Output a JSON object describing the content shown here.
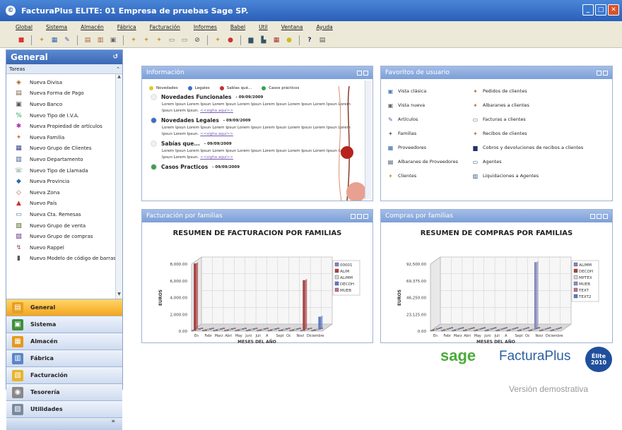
{
  "window": {
    "title": "FacturaPlus ELITE: 01  Empresa de pruebas Sage SP."
  },
  "menu": [
    "Global",
    "Sistema",
    "Almacén",
    "Fábrica",
    "Facturación",
    "Informes",
    "Babel",
    "Util",
    "Ventana",
    "Ayuda"
  ],
  "sidebar": {
    "title": "General",
    "section": "Tareas",
    "items": [
      {
        "label": "Nueva Divisa",
        "icon": "coins-icon"
      },
      {
        "label": "Nueva Forma de Pago",
        "icon": "payment-icon"
      },
      {
        "label": "Nuevo Banco",
        "icon": "bank-icon"
      },
      {
        "label": "Nuevo Tipo de I.V.A.",
        "icon": "tax-icon"
      },
      {
        "label": "Nueva Propiedad de artículos",
        "icon": "property-icon"
      },
      {
        "label": "Nueva Familia",
        "icon": "family-icon"
      },
      {
        "label": "Nuevo Grupo de Clientes",
        "icon": "group-icon"
      },
      {
        "label": "Nuevo Departamento",
        "icon": "department-icon"
      },
      {
        "label": "Nuevo Tipo de Llamada",
        "icon": "phone-icon"
      },
      {
        "label": "Nueva Provincia",
        "icon": "province-icon"
      },
      {
        "label": "Nueva Zona",
        "icon": "zone-icon"
      },
      {
        "label": "Nuevo País",
        "icon": "country-icon"
      },
      {
        "label": "Nueva Cta. Remesas",
        "icon": "remittance-icon"
      },
      {
        "label": "Nuevo Grupo de venta",
        "icon": "sales-group-icon"
      },
      {
        "label": "Nuevo Grupo de compras",
        "icon": "purchase-group-icon"
      },
      {
        "label": "Nuevo Rappel",
        "icon": "rappel-icon"
      },
      {
        "label": "Nuevo Modelo de código de barras",
        "icon": "barcode-icon"
      }
    ],
    "nav": [
      {
        "label": "General",
        "color": "#e8a020",
        "active": true
      },
      {
        "label": "Sistema",
        "color": "#3f8f3a",
        "active": false
      },
      {
        "label": "Almacén",
        "color": "#e39a1c",
        "active": false
      },
      {
        "label": "Fábrica",
        "color": "#5a86c8",
        "active": false
      },
      {
        "label": "Facturación",
        "color": "#e8b428",
        "active": false
      },
      {
        "label": "Tesorería",
        "color": "#888888",
        "active": false
      },
      {
        "label": "Utilidades",
        "color": "#7a8aa0",
        "active": false
      }
    ]
  },
  "info_panel": {
    "title": "Información",
    "legend": [
      {
        "label": "Novedades",
        "color": "#e0c830"
      },
      {
        "label": "Legales",
        "color": "#3a6fc0"
      },
      {
        "label": "Sabías qué...",
        "color": "#c03030"
      },
      {
        "label": "Casos prácticos",
        "color": "#3aa050"
      }
    ],
    "news": [
      {
        "title": "Novedades Funcionales",
        "date": "- 09/09/2009",
        "dot": "#f0f0f0",
        "body": "Lorem Ipsun Lorem Ipsun Lorem Ipsun Lorem Ipsun Lorem Ipsun Lorem Ipsun Lorem Ipsun Lorem Ipsun Lorem Ipsun.",
        "link": "<<sigha aquí>>"
      },
      {
        "title": "Novedades Legales",
        "date": "- 09/09/2009",
        "dot": "#3a6fc0",
        "body": "Lorem Ipsun Lorem Ipsun Lorem Ipsun Lorem Ipsun Lorem Ipsun Lorem Ipsun Lorem Ipsun Lorem Ipsun Lorem Ipsun.",
        "link": "<<sigha aquí>>"
      },
      {
        "title": "Sabías que...",
        "date": "- 09/09/2009",
        "dot": "#f0f0f0",
        "body": "Lorem Ipsun Lorem Ipsun Lorem Ipsun Lorem Ipsun Lorem Ipsun Lorem Ipsun Lorem Ipsun Lorem Ipsun Lorem Ipsun.",
        "link": "<<sigha aquí>>"
      },
      {
        "title": "Casos Practicos",
        "date": "- 09/09/2009",
        "dot": "#3aa050",
        "body": "",
        "link": ""
      }
    ]
  },
  "favorites": {
    "title": "Favoritos de usuario",
    "left": [
      {
        "label": "Vista clásica",
        "icon": "classic-view-icon"
      },
      {
        "label": "Vista nueva",
        "icon": "new-view-icon"
      },
      {
        "label": "Artículos",
        "icon": "articles-icon"
      },
      {
        "label": "Familias",
        "icon": "families-icon"
      },
      {
        "label": "Proveedores",
        "icon": "suppliers-icon"
      },
      {
        "label": "Albaranes de Proveedores",
        "icon": "supplier-notes-icon"
      },
      {
        "label": "Clientes",
        "icon": "clients-icon"
      }
    ],
    "right": [
      {
        "label": "Pedidos de clientes",
        "icon": "orders-icon"
      },
      {
        "label": "Albaranes a clientes",
        "icon": "delivery-notes-icon"
      },
      {
        "label": "Facturas a clientes",
        "icon": "invoices-icon"
      },
      {
        "label": "Recibos de clientes",
        "icon": "receipts-icon"
      },
      {
        "label": "Cobros y devoluciones de recibos a clientes",
        "icon": "collections-icon"
      },
      {
        "label": "Agentes",
        "icon": "agents-icon"
      },
      {
        "label": "Liquidaciones a Agentes",
        "icon": "settlements-icon"
      }
    ]
  },
  "billing_panel": {
    "title": "Facturación por familias"
  },
  "purchases_panel": {
    "title": "Compras por familias"
  },
  "chart_data": [
    {
      "type": "bar",
      "title": "RESUMEN DE FACTURACION POR FAMILIAS",
      "xlabel": "MESES DEL AÑO",
      "ylabel": "EUROS",
      "yticks": [
        "8,000.00",
        "6,000.00",
        "4,000.00",
        "2,000.00",
        "0.00"
      ],
      "ylim": [
        0,
        8000
      ],
      "categories": [
        "En",
        "Febr",
        "Marz",
        "Abri",
        "May",
        "Juni",
        "Juli",
        "A",
        "Sept",
        "Oc",
        "Novi",
        "Diciembre"
      ],
      "series": [
        {
          "name": "00001",
          "color": "#8a82c0",
          "values": [
            0,
            0,
            0,
            0,
            0,
            0,
            0,
            0,
            0,
            0,
            0,
            0
          ]
        },
        {
          "name": "ALIM",
          "color": "#b04040",
          "values": [
            8000,
            0,
            0,
            0,
            0,
            0,
            0,
            0,
            0,
            0,
            6000,
            0
          ]
        },
        {
          "name": "ALIMM",
          "color": "#d8d8d8",
          "values": [
            0,
            0,
            0,
            0,
            0,
            0,
            0,
            0,
            0,
            0,
            0,
            0
          ]
        },
        {
          "name": "DECOH",
          "color": "#5a7ad0",
          "values": [
            0,
            0,
            0,
            0,
            0,
            0,
            0,
            0,
            0,
            0,
            0,
            1500
          ]
        },
        {
          "name": "MUEB",
          "color": "#c07090",
          "values": [
            0,
            0,
            0,
            0,
            0,
            0,
            0,
            0,
            0,
            0,
            0,
            0
          ]
        }
      ]
    },
    {
      "type": "bar",
      "title": "RESUMEN DE COMPRAS POR FAMILIAS",
      "xlabel": "MESES DEL AÑO",
      "ylabel": "EUROS",
      "yticks": [
        "92,500.00",
        "69,375.00",
        "46,250.00",
        "23,125.00",
        "0.00"
      ],
      "ylim": [
        0,
        92500
      ],
      "categories": [
        "En",
        "Febr",
        "Marz",
        "Abri",
        "May",
        "Juni",
        "Juli",
        "A",
        "Sept",
        "Oc",
        "Novi",
        "Diciembre"
      ],
      "series": [
        {
          "name": "ALIMM",
          "color": "#8a82c0",
          "values": [
            0,
            0,
            0,
            0,
            0,
            0,
            0,
            0,
            0,
            0,
            0,
            0
          ]
        },
        {
          "name": "DECOH",
          "color": "#b04040",
          "values": [
            0,
            0,
            0,
            0,
            0,
            0,
            0,
            0,
            0,
            0,
            0,
            0
          ]
        },
        {
          "name": "MPTEX",
          "color": "#d8d8d8",
          "values": [
            0,
            0,
            0,
            0,
            0,
            0,
            0,
            0,
            0,
            0,
            0,
            0
          ]
        },
        {
          "name": "MUEB",
          "color": "#8a8fc8",
          "values": [
            0,
            0,
            0,
            0,
            0,
            0,
            0,
            0,
            0,
            92500,
            0,
            0
          ]
        },
        {
          "name": "TEXT",
          "color": "#c07090",
          "values": [
            0,
            0,
            0,
            0,
            0,
            0,
            0,
            0,
            0,
            0,
            0,
            0
          ]
        },
        {
          "name": "TEXT2",
          "color": "#5a7ad0",
          "values": [
            0,
            0,
            0,
            0,
            0,
            0,
            0,
            0,
            0,
            0,
            0,
            0
          ]
        }
      ]
    }
  ],
  "branding": {
    "sage": "sage",
    "product": "FacturaPlus",
    "edition": "Élite",
    "year": "2010",
    "version": "Versión demostrativa"
  }
}
